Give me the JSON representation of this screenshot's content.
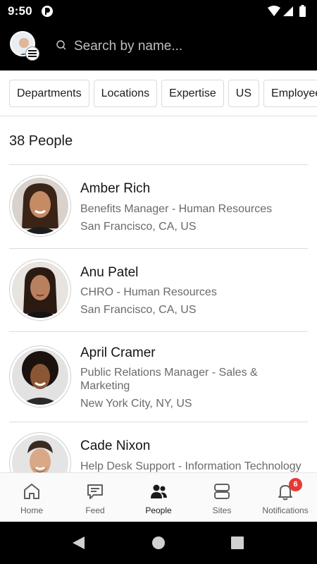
{
  "status_bar": {
    "time": "9:50"
  },
  "header": {
    "search_placeholder": "Search by name..."
  },
  "filters": {
    "chips": [
      "Departments",
      "Locations",
      "Expertise",
      "US",
      "Employee"
    ]
  },
  "results": {
    "count_label": "38 People"
  },
  "people": [
    {
      "name": "Amber Rich",
      "title": "Benefits Manager - Human Resources",
      "location": "San Francisco, CA, US"
    },
    {
      "name": "Anu Patel",
      "title": "CHRO - Human Resources",
      "location": "San Francisco, CA, US"
    },
    {
      "name": "April Cramer",
      "title": "Public Relations Manager - Sales & Marketing",
      "location": "New York City, NY, US"
    },
    {
      "name": "Cade Nixon",
      "title": "Help Desk Support - Information Technology",
      "location": ""
    }
  ],
  "bottom_nav": {
    "items": [
      {
        "label": "Home",
        "icon": "home-icon"
      },
      {
        "label": "Feed",
        "icon": "feed-icon"
      },
      {
        "label": "People",
        "icon": "people-icon",
        "active": true
      },
      {
        "label": "Sites",
        "icon": "sites-icon"
      },
      {
        "label": "Notifications",
        "icon": "bell-icon"
      }
    ],
    "notification_count": "6"
  },
  "colors": {
    "badge": "#e53935",
    "header_bg": "#000000",
    "text_primary": "#141414",
    "text_secondary": "#6a6a6a"
  }
}
